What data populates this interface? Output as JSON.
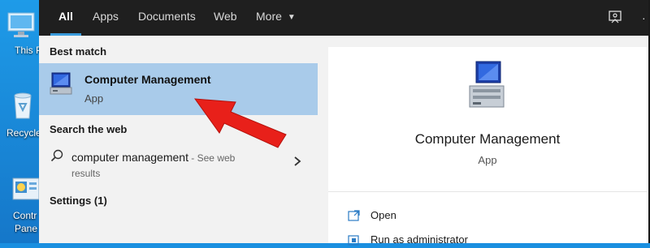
{
  "desktop": {
    "icons": [
      {
        "name": "this-pc",
        "label": "This P",
        "icon": "monitor-icon"
      },
      {
        "name": "recycle-bin",
        "label": "Recycle",
        "icon": "recycle-bin-icon"
      },
      {
        "name": "control-panel",
        "label": "Contr",
        "label2": "Pane",
        "icon": "control-panel-icon"
      }
    ]
  },
  "tabs": [
    {
      "label": "All",
      "active": true
    },
    {
      "label": "Apps"
    },
    {
      "label": "Documents"
    },
    {
      "label": "Web"
    },
    {
      "label": "More"
    }
  ],
  "topbar_icons": [
    "feedback-icon",
    "more-dots-icon"
  ],
  "best_match": {
    "heading": "Best match",
    "title": "Computer Management",
    "subtitle": "App",
    "icon": "computer-management-icon"
  },
  "search_web": {
    "heading": "Search the web",
    "query": "computer management",
    "see": " - See web",
    "results": "results"
  },
  "settings": {
    "heading": "Settings (1)"
  },
  "detail": {
    "title": "Computer Management",
    "subtitle": "App",
    "actions": [
      {
        "label": "Open",
        "icon": "open-window-icon"
      },
      {
        "label": "Run as administrator",
        "icon": "shield-icon"
      }
    ]
  },
  "colors": {
    "accent": "#3a9bdc",
    "selection": "#a9cbea",
    "topbar": "#1f1f1f",
    "arrow": "#e8201a"
  }
}
